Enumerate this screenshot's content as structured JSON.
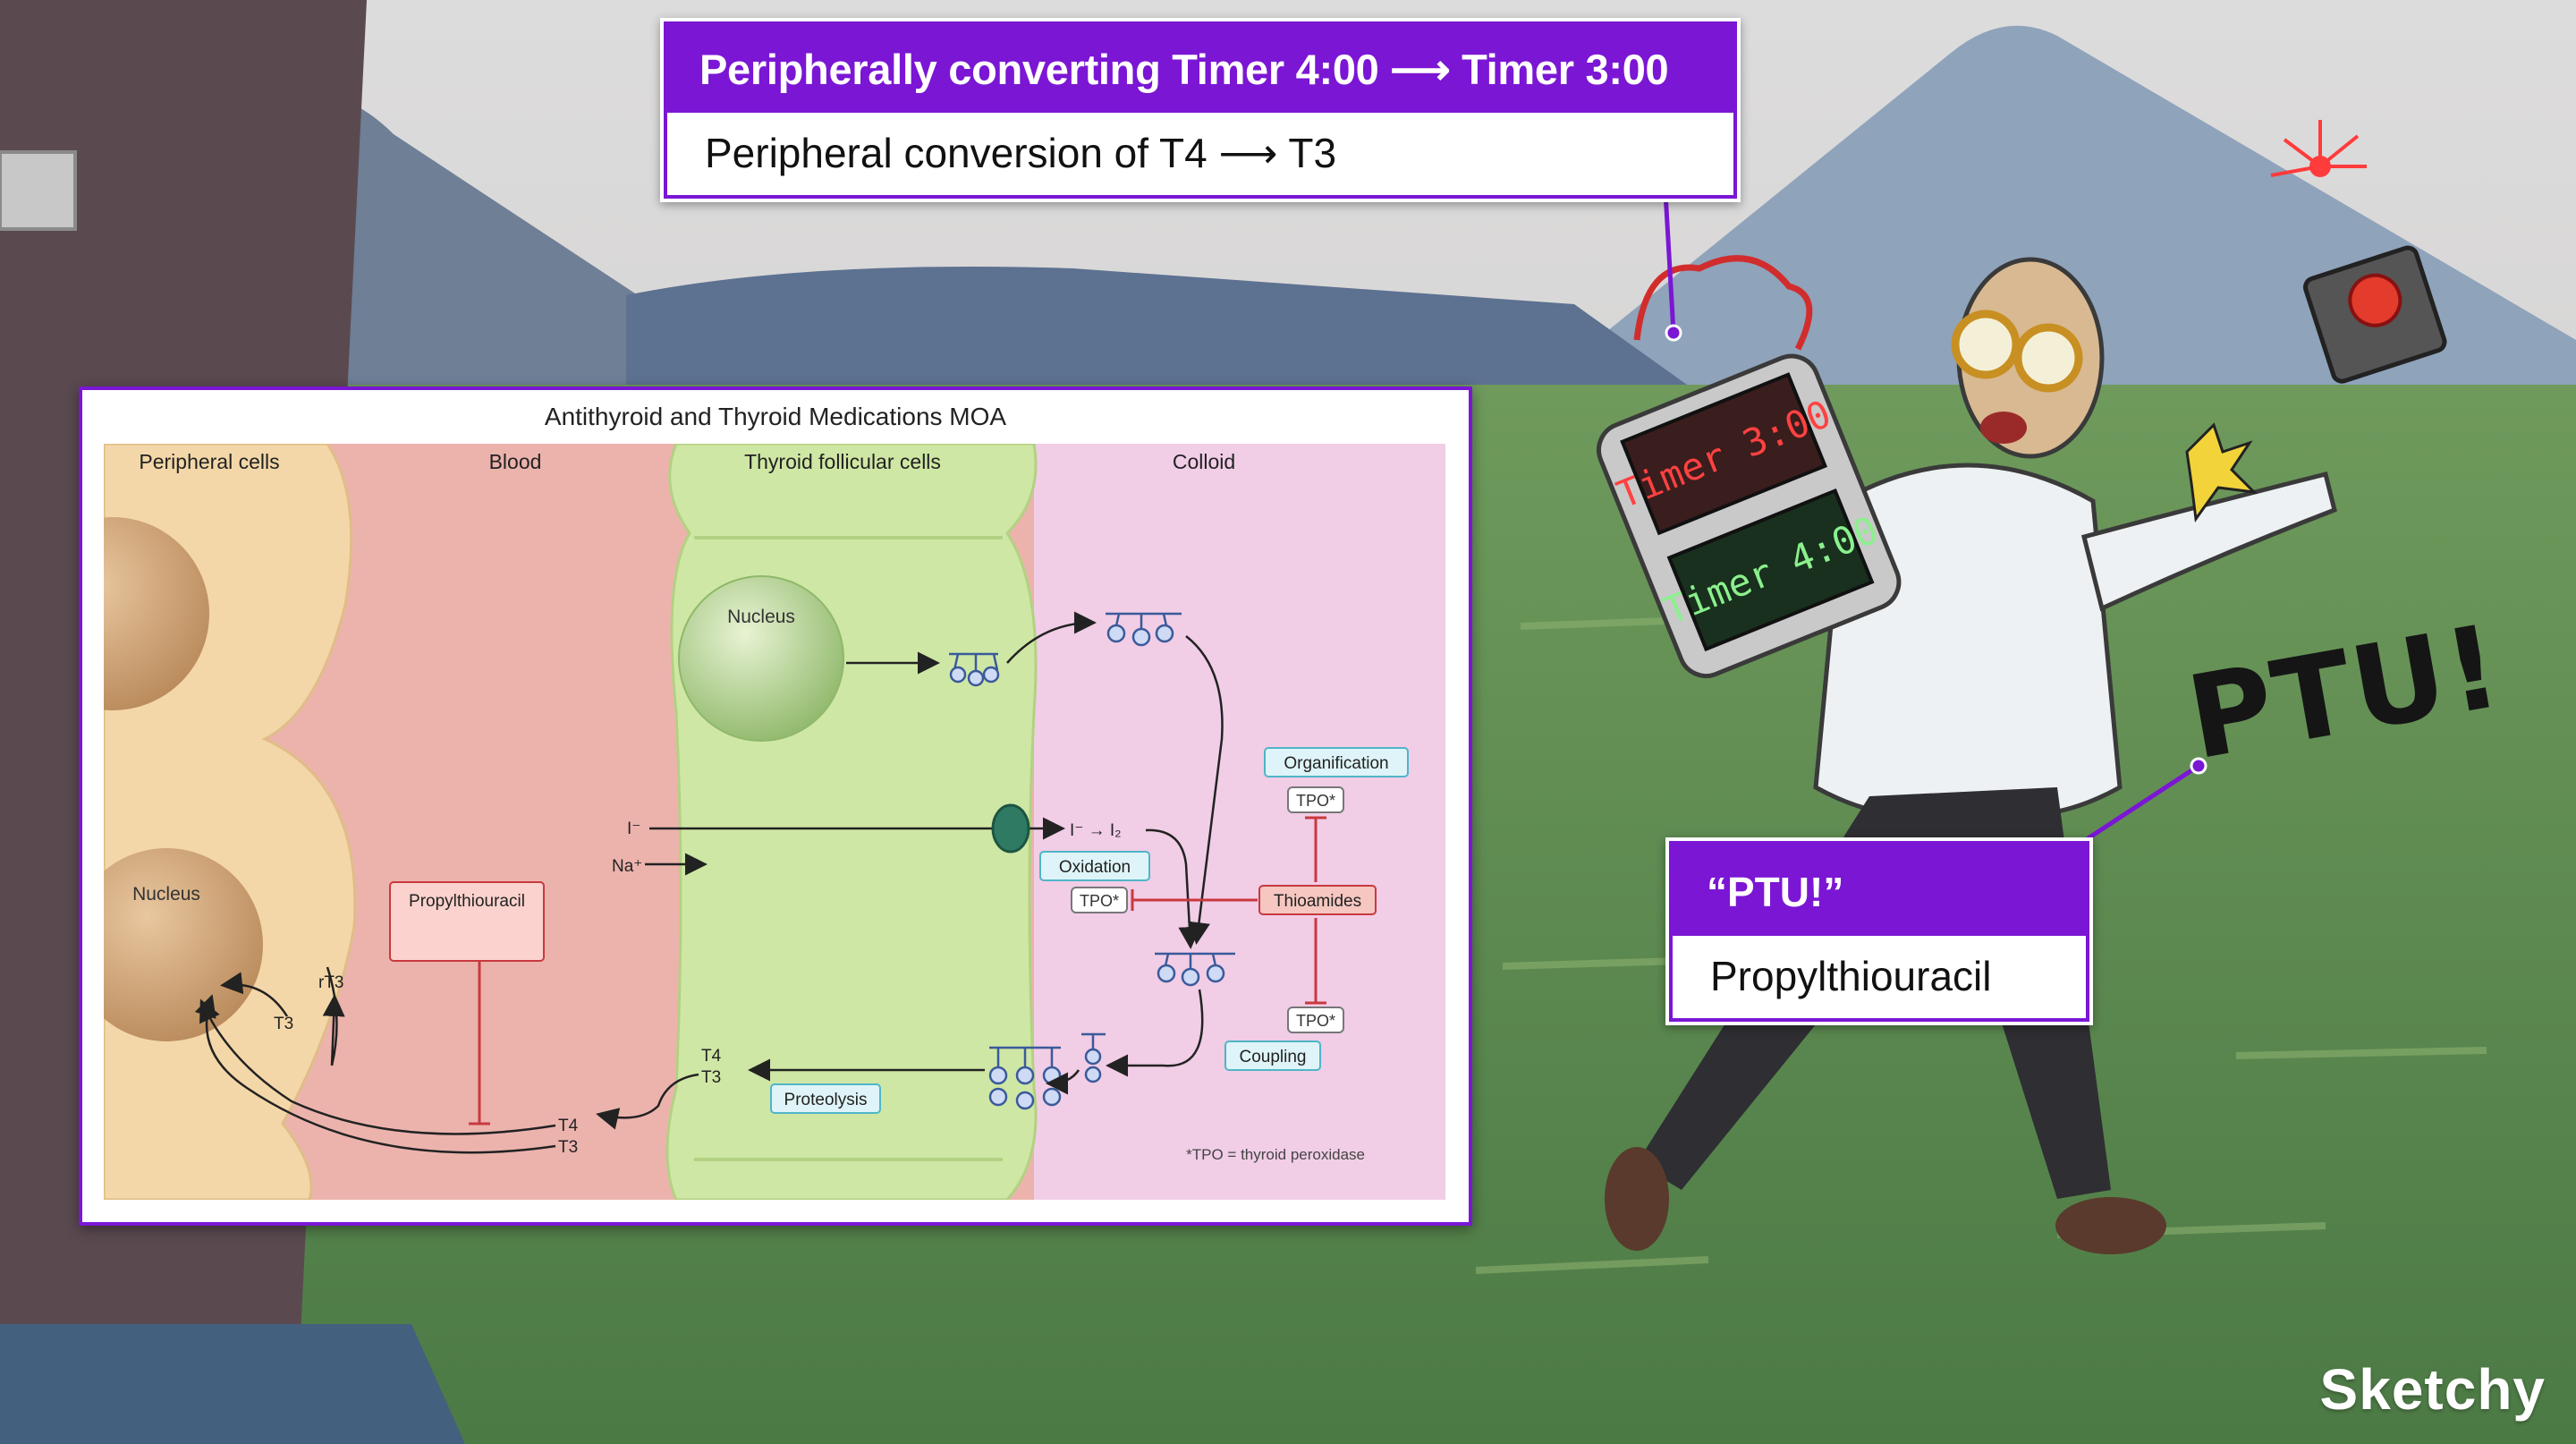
{
  "callout_top": {
    "header": "Peripherally converting Timer 4:00 ⟶ Timer 3:00",
    "body": "Peripheral conversion of T4 ⟶ T3"
  },
  "callout_ptu": {
    "header": "“PTU!”",
    "body": "Propylthiouracil"
  },
  "scene_text": {
    "ptu_scribble": "PTU!",
    "timer_red": "Timer 3:00",
    "timer_green": "Timer 4:00"
  },
  "diagram": {
    "title": "Antithyroid and Thyroid Medications MOA",
    "regions": [
      "Peripheral cells",
      "Blood",
      "Thyroid follicular cells",
      "Colloid"
    ],
    "nucleus_label": "Nucleus",
    "labels": {
      "iodide": "I⁻",
      "sodium": "Na⁺",
      "iodide_conv": "I⁻ → I₂",
      "t4": "T4",
      "t3": "T3",
      "rt3": "rT3",
      "tpo": "TPO*",
      "footnote": "*TPO = thyroid peroxidase"
    },
    "boxes": {
      "propylthiouracil": "Propylthiouracil",
      "organification": "Organification",
      "oxidation": "Oxidation",
      "thioamides": "Thioamides",
      "coupling": "Coupling",
      "proteolysis": "Proteolysis"
    }
  },
  "brand": "Sketchy",
  "colors": {
    "accent": "#7b16d4",
    "peripheral": "#f4d7a8",
    "blood": "#ecb3ad",
    "thyroid": "#cfe7a4",
    "colloid": "#f1cde6",
    "inhibit": "#c9393f"
  }
}
